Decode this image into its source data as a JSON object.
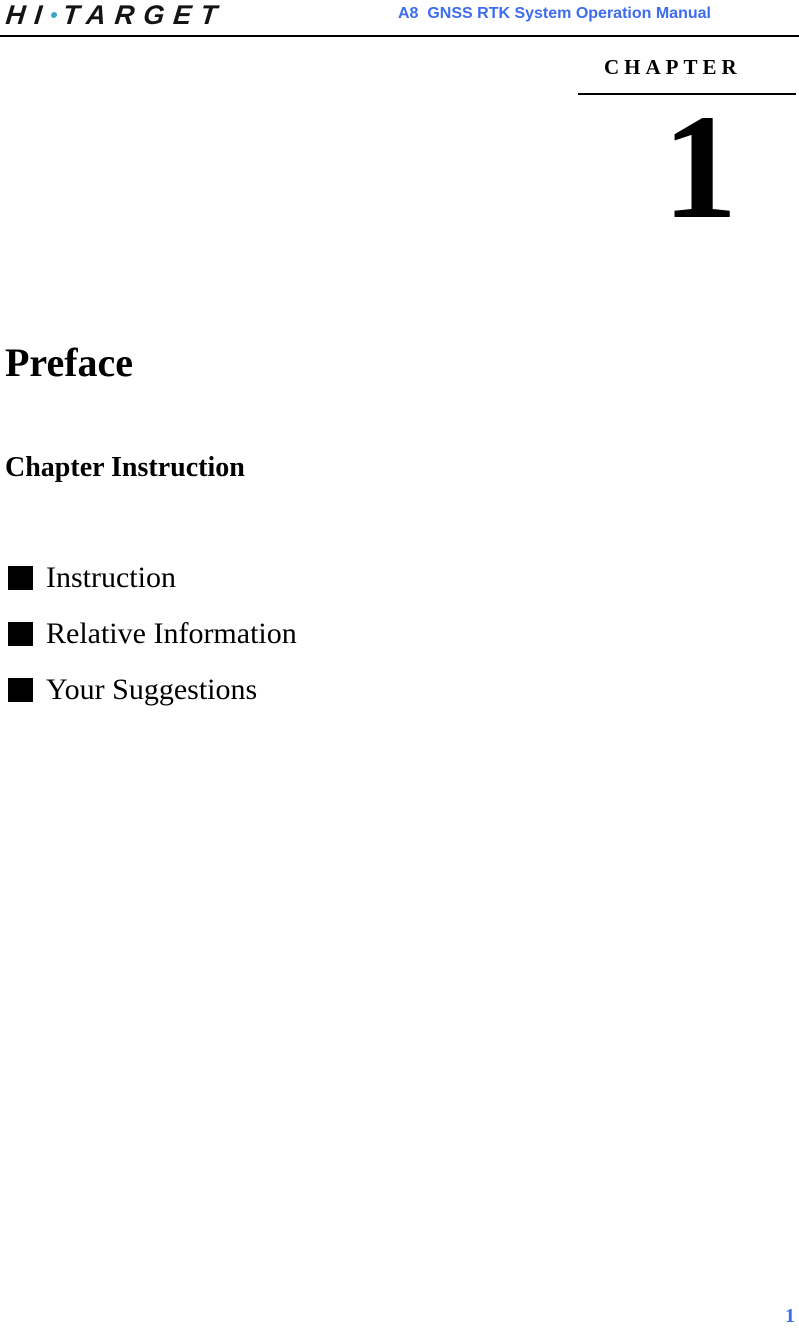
{
  "header": {
    "logo_text_left": "HI",
    "logo_text_right": "TARGET",
    "title": "A8  GNSS RTK System Operation Manual",
    "accent_color": "#3e6cf0"
  },
  "chapter": {
    "label": "CHAPTER",
    "number": "1"
  },
  "content": {
    "title": "Preface",
    "subtitle": "Chapter Instruction",
    "items": [
      {
        "icon": "square-bullet-icon",
        "label": "Instruction"
      },
      {
        "icon": "square-bullet-icon",
        "label": "Relative Information"
      },
      {
        "icon": "square-bullet-icon",
        "label": "Your Suggestions"
      }
    ]
  },
  "footer": {
    "page_number": "1"
  }
}
